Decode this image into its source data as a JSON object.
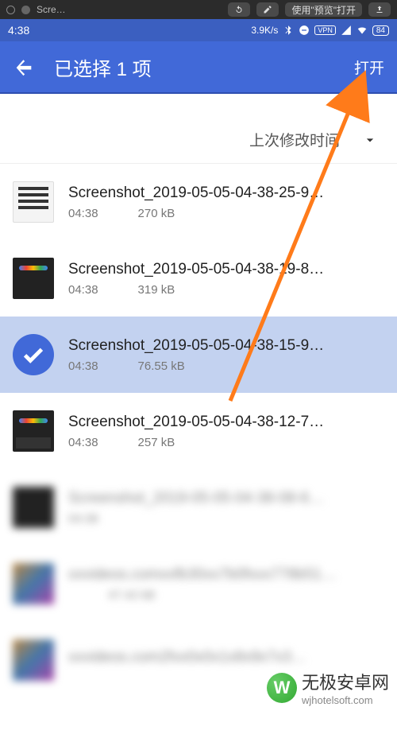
{
  "mac_chrome": {
    "tab_title": "Scre…",
    "open_with_label": "使用\"预览\"打开"
  },
  "statusbar": {
    "time": "4:38",
    "net_speed": "3.9K/s",
    "vpn": "VPN",
    "battery": "84"
  },
  "appbar": {
    "title": "已选择 1 项",
    "open": "打开"
  },
  "sort": {
    "label": "上次修改时间"
  },
  "files": [
    {
      "name": "Screenshot_2019-05-05-04-38-25-9…",
      "time": "04:38",
      "size": "270 kB",
      "selected": false,
      "thumb": "light"
    },
    {
      "name": "Screenshot_2019-05-05-04-38-19-8…",
      "time": "04:38",
      "size": "319 kB",
      "selected": false,
      "thumb": "dark-google"
    },
    {
      "name": "Screenshot_2019-05-05-04-38-15-9…",
      "time": "04:38",
      "size": "76.55 kB",
      "selected": true,
      "thumb": "check"
    },
    {
      "name": "Screenshot_2019-05-05-04-38-12-7…",
      "time": "04:38",
      "size": "257 kB",
      "selected": false,
      "thumb": "dark-kb"
    },
    {
      "name": "Screenshot_2019-05-05-04-38-08-6…",
      "time": "04:38",
      "size": "",
      "selected": false,
      "thumb": "blur-dark",
      "blurred": true
    },
    {
      "name": "xxvideos.comxxfb30xx7b0fxxx778b51…",
      "time": "",
      "size": "47.42 kB",
      "selected": false,
      "thumb": "blur-color",
      "blurred": true
    },
    {
      "name": "xxvideos.com2fxx0x0x1x8x9x7x3…",
      "time": "",
      "size": "",
      "selected": false,
      "thumb": "blur-color",
      "blurred": true
    }
  ],
  "watermark": {
    "text": "无极安卓网",
    "url": "wjhotelsoft.com",
    "logo_letter": "W"
  }
}
